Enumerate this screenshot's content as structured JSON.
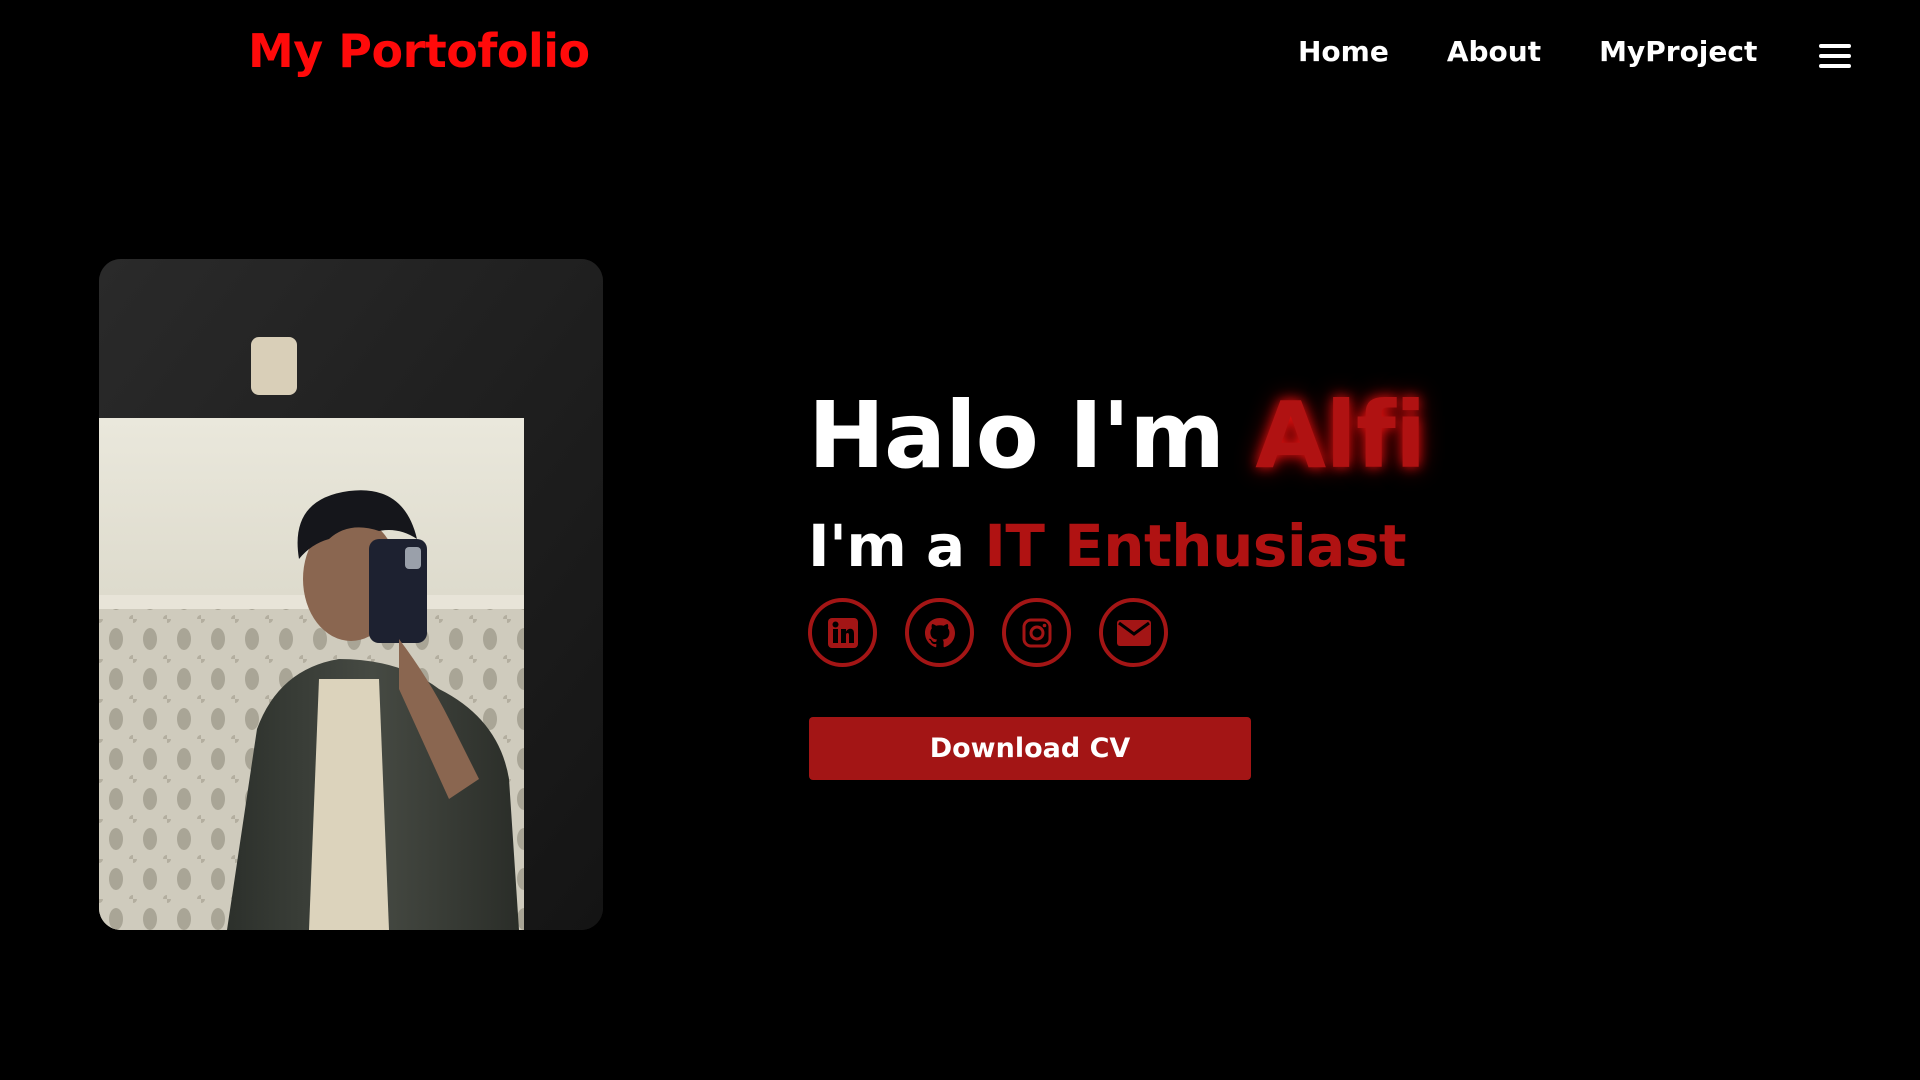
{
  "nav": {
    "logo": "My Portofolio",
    "links": [
      {
        "label": "Home"
      },
      {
        "label": "About"
      },
      {
        "label": "MyProject"
      }
    ],
    "menu_icon": "hamburger-menu-icon"
  },
  "hero": {
    "greeting": "Halo I'm",
    "name": "Alfi",
    "role_prefix": "I'm a",
    "role": "IT Enthusiast",
    "download_label": "Download CV"
  },
  "social": [
    {
      "icon": "linkedin-icon"
    },
    {
      "icon": "github-icon"
    },
    {
      "icon": "instagram-icon"
    },
    {
      "icon": "email-icon"
    }
  ],
  "colors": {
    "background": "#000000",
    "logo": "#ff0a0a",
    "accent": "#a31515",
    "text": "#ffffff"
  }
}
